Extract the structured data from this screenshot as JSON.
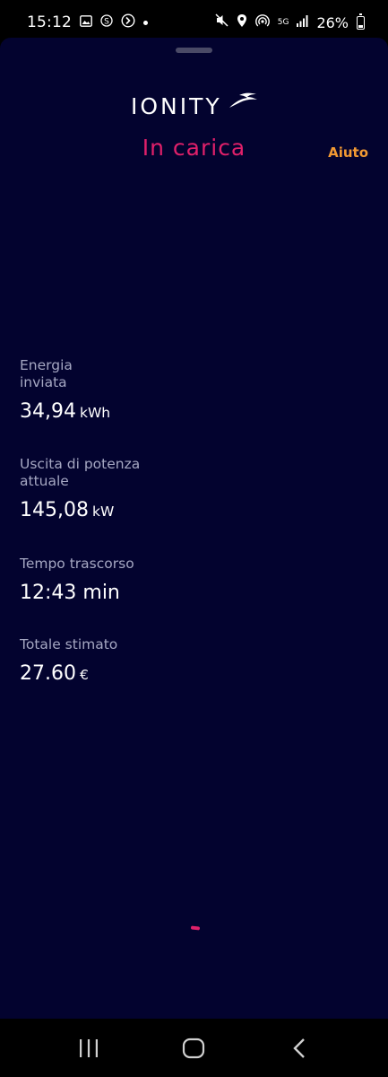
{
  "status_bar": {
    "time": "15:12",
    "network": "5G",
    "battery": "26%",
    "icons": [
      "gallery-icon",
      "s-app-icon",
      "arrow-circle-icon",
      "notification-dot",
      "mute-vibrate-icon",
      "location-icon",
      "hotspot-icon",
      "signal-icon",
      "battery-icon"
    ]
  },
  "header": {
    "logo_text": "IONITY",
    "title": "In carica",
    "help_label": "Aiuto"
  },
  "metrics": [
    {
      "label": "Energia inviata",
      "value": "34,94",
      "unit": "kWh"
    },
    {
      "label": "Uscita di potenza attuale",
      "value": "145,08",
      "unit": "kW"
    },
    {
      "label": "Tempo trascorso",
      "value": "12:43 min",
      "unit": ""
    },
    {
      "label": "Totale stimato",
      "value": "27.60",
      "unit": "€"
    }
  ],
  "colors": {
    "background": "#03032f",
    "title": "#e0206a",
    "help": "#f29a33",
    "label": "#a5a7c2",
    "value": "#ffffff"
  },
  "nav_bar": {
    "icons": [
      "recents-icon",
      "home-icon",
      "back-icon"
    ]
  }
}
